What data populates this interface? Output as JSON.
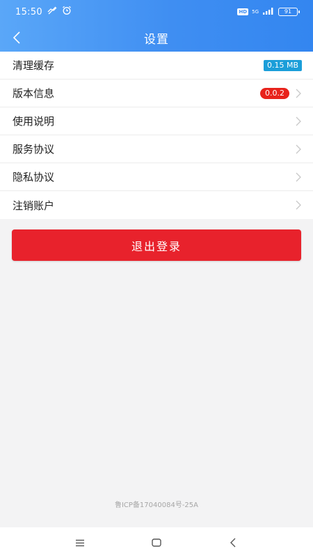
{
  "status_bar": {
    "time": "15:50",
    "hd": "HD",
    "network": "5G",
    "battery": "91"
  },
  "header": {
    "title": "设置"
  },
  "settings": {
    "items": [
      {
        "label": "清理缓存",
        "badge": "0.15 MB"
      },
      {
        "label": "版本信息",
        "badge": "0.0.2"
      },
      {
        "label": "使用说明"
      },
      {
        "label": "服务协议"
      },
      {
        "label": "隐私协议"
      },
      {
        "label": "注销账户"
      }
    ]
  },
  "logout": {
    "label": "退出登录"
  },
  "footer": {
    "icp": "鲁ICP备17040084号-25A"
  },
  "colors": {
    "header_start": "#5aa7f8",
    "header_end": "#3386f0",
    "logout_bg": "#e8222c",
    "cache_badge": "#1b9ed9",
    "version_badge": "#e8231c"
  }
}
